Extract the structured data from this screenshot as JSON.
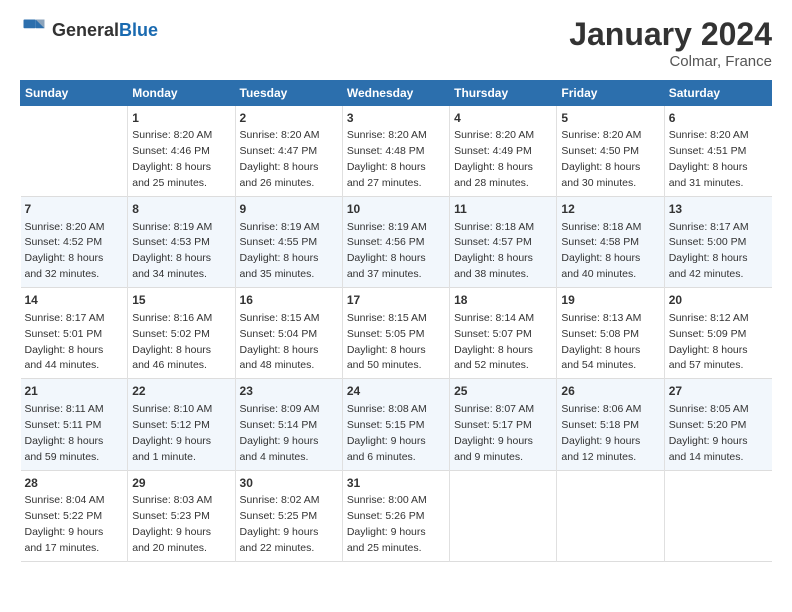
{
  "header": {
    "logo_general": "General",
    "logo_blue": "Blue",
    "main_title": "January 2024",
    "subtitle": "Colmar, France"
  },
  "columns": [
    "Sunday",
    "Monday",
    "Tuesday",
    "Wednesday",
    "Thursday",
    "Friday",
    "Saturday"
  ],
  "weeks": [
    [
      {
        "day": "",
        "sunrise": "",
        "sunset": "",
        "daylight": ""
      },
      {
        "day": "1",
        "sunrise": "Sunrise: 8:20 AM",
        "sunset": "Sunset: 4:46 PM",
        "daylight": "Daylight: 8 hours and 25 minutes."
      },
      {
        "day": "2",
        "sunrise": "Sunrise: 8:20 AM",
        "sunset": "Sunset: 4:47 PM",
        "daylight": "Daylight: 8 hours and 26 minutes."
      },
      {
        "day": "3",
        "sunrise": "Sunrise: 8:20 AM",
        "sunset": "Sunset: 4:48 PM",
        "daylight": "Daylight: 8 hours and 27 minutes."
      },
      {
        "day": "4",
        "sunrise": "Sunrise: 8:20 AM",
        "sunset": "Sunset: 4:49 PM",
        "daylight": "Daylight: 8 hours and 28 minutes."
      },
      {
        "day": "5",
        "sunrise": "Sunrise: 8:20 AM",
        "sunset": "Sunset: 4:50 PM",
        "daylight": "Daylight: 8 hours and 30 minutes."
      },
      {
        "day": "6",
        "sunrise": "Sunrise: 8:20 AM",
        "sunset": "Sunset: 4:51 PM",
        "daylight": "Daylight: 8 hours and 31 minutes."
      }
    ],
    [
      {
        "day": "7",
        "sunrise": "Sunrise: 8:20 AM",
        "sunset": "Sunset: 4:52 PM",
        "daylight": "Daylight: 8 hours and 32 minutes."
      },
      {
        "day": "8",
        "sunrise": "Sunrise: 8:19 AM",
        "sunset": "Sunset: 4:53 PM",
        "daylight": "Daylight: 8 hours and 34 minutes."
      },
      {
        "day": "9",
        "sunrise": "Sunrise: 8:19 AM",
        "sunset": "Sunset: 4:55 PM",
        "daylight": "Daylight: 8 hours and 35 minutes."
      },
      {
        "day": "10",
        "sunrise": "Sunrise: 8:19 AM",
        "sunset": "Sunset: 4:56 PM",
        "daylight": "Daylight: 8 hours and 37 minutes."
      },
      {
        "day": "11",
        "sunrise": "Sunrise: 8:18 AM",
        "sunset": "Sunset: 4:57 PM",
        "daylight": "Daylight: 8 hours and 38 minutes."
      },
      {
        "day": "12",
        "sunrise": "Sunrise: 8:18 AM",
        "sunset": "Sunset: 4:58 PM",
        "daylight": "Daylight: 8 hours and 40 minutes."
      },
      {
        "day": "13",
        "sunrise": "Sunrise: 8:17 AM",
        "sunset": "Sunset: 5:00 PM",
        "daylight": "Daylight: 8 hours and 42 minutes."
      }
    ],
    [
      {
        "day": "14",
        "sunrise": "Sunrise: 8:17 AM",
        "sunset": "Sunset: 5:01 PM",
        "daylight": "Daylight: 8 hours and 44 minutes."
      },
      {
        "day": "15",
        "sunrise": "Sunrise: 8:16 AM",
        "sunset": "Sunset: 5:02 PM",
        "daylight": "Daylight: 8 hours and 46 minutes."
      },
      {
        "day": "16",
        "sunrise": "Sunrise: 8:15 AM",
        "sunset": "Sunset: 5:04 PM",
        "daylight": "Daylight: 8 hours and 48 minutes."
      },
      {
        "day": "17",
        "sunrise": "Sunrise: 8:15 AM",
        "sunset": "Sunset: 5:05 PM",
        "daylight": "Daylight: 8 hours and 50 minutes."
      },
      {
        "day": "18",
        "sunrise": "Sunrise: 8:14 AM",
        "sunset": "Sunset: 5:07 PM",
        "daylight": "Daylight: 8 hours and 52 minutes."
      },
      {
        "day": "19",
        "sunrise": "Sunrise: 8:13 AM",
        "sunset": "Sunset: 5:08 PM",
        "daylight": "Daylight: 8 hours and 54 minutes."
      },
      {
        "day": "20",
        "sunrise": "Sunrise: 8:12 AM",
        "sunset": "Sunset: 5:09 PM",
        "daylight": "Daylight: 8 hours and 57 minutes."
      }
    ],
    [
      {
        "day": "21",
        "sunrise": "Sunrise: 8:11 AM",
        "sunset": "Sunset: 5:11 PM",
        "daylight": "Daylight: 8 hours and 59 minutes."
      },
      {
        "day": "22",
        "sunrise": "Sunrise: 8:10 AM",
        "sunset": "Sunset: 5:12 PM",
        "daylight": "Daylight: 9 hours and 1 minute."
      },
      {
        "day": "23",
        "sunrise": "Sunrise: 8:09 AM",
        "sunset": "Sunset: 5:14 PM",
        "daylight": "Daylight: 9 hours and 4 minutes."
      },
      {
        "day": "24",
        "sunrise": "Sunrise: 8:08 AM",
        "sunset": "Sunset: 5:15 PM",
        "daylight": "Daylight: 9 hours and 6 minutes."
      },
      {
        "day": "25",
        "sunrise": "Sunrise: 8:07 AM",
        "sunset": "Sunset: 5:17 PM",
        "daylight": "Daylight: 9 hours and 9 minutes."
      },
      {
        "day": "26",
        "sunrise": "Sunrise: 8:06 AM",
        "sunset": "Sunset: 5:18 PM",
        "daylight": "Daylight: 9 hours and 12 minutes."
      },
      {
        "day": "27",
        "sunrise": "Sunrise: 8:05 AM",
        "sunset": "Sunset: 5:20 PM",
        "daylight": "Daylight: 9 hours and 14 minutes."
      }
    ],
    [
      {
        "day": "28",
        "sunrise": "Sunrise: 8:04 AM",
        "sunset": "Sunset: 5:22 PM",
        "daylight": "Daylight: 9 hours and 17 minutes."
      },
      {
        "day": "29",
        "sunrise": "Sunrise: 8:03 AM",
        "sunset": "Sunset: 5:23 PM",
        "daylight": "Daylight: 9 hours and 20 minutes."
      },
      {
        "day": "30",
        "sunrise": "Sunrise: 8:02 AM",
        "sunset": "Sunset: 5:25 PM",
        "daylight": "Daylight: 9 hours and 22 minutes."
      },
      {
        "day": "31",
        "sunrise": "Sunrise: 8:00 AM",
        "sunset": "Sunset: 5:26 PM",
        "daylight": "Daylight: 9 hours and 25 minutes."
      },
      {
        "day": "",
        "sunrise": "",
        "sunset": "",
        "daylight": ""
      },
      {
        "day": "",
        "sunrise": "",
        "sunset": "",
        "daylight": ""
      },
      {
        "day": "",
        "sunrise": "",
        "sunset": "",
        "daylight": ""
      }
    ]
  ]
}
